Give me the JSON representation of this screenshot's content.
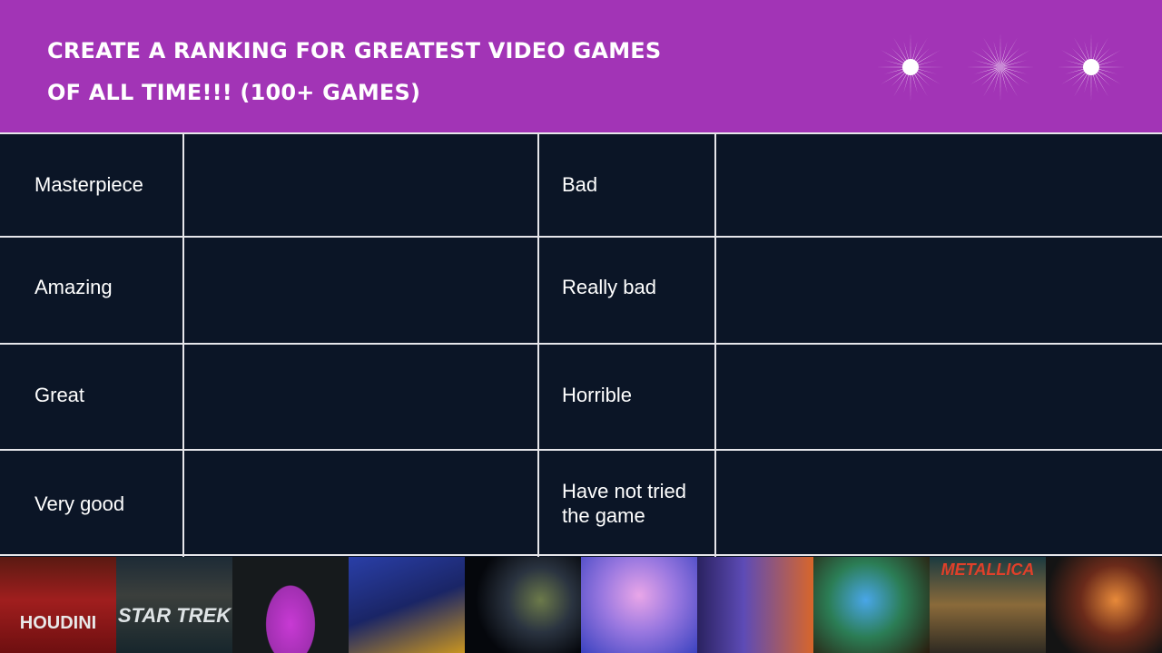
{
  "header": {
    "title": "CREATE A RANKING FOR GREATEST VIDEO GAMES\nOF ALL TIME!!! (100+ GAMES)",
    "accent_color": "#a234b6",
    "decorations": [
      "starburst-icon",
      "starburst-icon",
      "starburst-icon"
    ]
  },
  "tiers": {
    "left": [
      {
        "label": "Masterpiece"
      },
      {
        "label": "Amazing"
      },
      {
        "label": "Great"
      },
      {
        "label": "Very good"
      }
    ],
    "right": [
      {
        "label": "Bad"
      },
      {
        "label": "Really bad"
      },
      {
        "label": "Horrible"
      },
      {
        "label": "Have not tried the game"
      }
    ]
  },
  "gallery": {
    "items": [
      {
        "name": "houdini-image",
        "caption": "HOUDINI"
      },
      {
        "name": "star-trek-image",
        "caption": "STAR TREK"
      },
      {
        "name": "pink-hoodie-figure-image",
        "caption": ""
      },
      {
        "name": "tracer-figure-image",
        "caption": ""
      },
      {
        "name": "kakashi-figure-image",
        "caption": ""
      },
      {
        "name": "anime-girl-image",
        "caption": ""
      },
      {
        "name": "vr-headset-image",
        "caption": ""
      },
      {
        "name": "yoda-image",
        "caption": ""
      },
      {
        "name": "metallica-image",
        "caption": "METALLICA"
      },
      {
        "name": "stormtrooper-figure-image",
        "caption": ""
      }
    ]
  }
}
